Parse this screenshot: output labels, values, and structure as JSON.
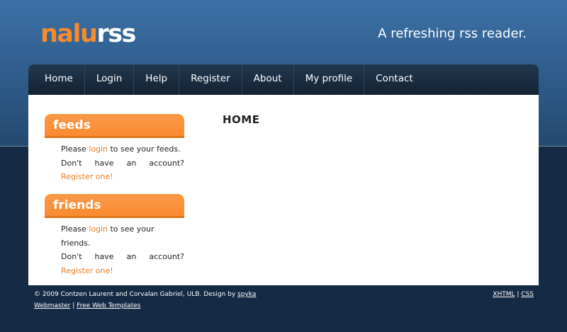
{
  "logo": {
    "part1": "nalu",
    "part2": "rss"
  },
  "tagline": "A refreshing rss reader.",
  "nav": {
    "items": [
      "Home",
      "Login",
      "Help",
      "Register",
      "About",
      "My profile",
      "Contact"
    ]
  },
  "feeds": {
    "title": "feeds",
    "text_before": "Please ",
    "login_link": "login",
    "text_after": " to see your feeds.",
    "line2": "Don't have an account?",
    "register_link": "Register one!"
  },
  "friends": {
    "title": "friends",
    "text_before": "Please ",
    "login_link": "login",
    "text_after": " to see your friends.",
    "line2": "Don't have an account?",
    "register_link": "Register one!"
  },
  "main": {
    "title": "HOME"
  },
  "footer": {
    "credit": "© 2009 Contzen Laurent and Corvalan Gabriel, ULB. Design by ",
    "designer_link": "spyka",
    "webmaster_link": "Webmaster",
    "separator": " | ",
    "templates_link": "Free Web Templates",
    "xhtml_link": "XHTML",
    "css_link": "CSS"
  },
  "colors": {
    "accent": "#f68a2e",
    "header_blue": "#2f5d8d",
    "nav_dark": "#132233",
    "background_dark": "#152a44"
  }
}
